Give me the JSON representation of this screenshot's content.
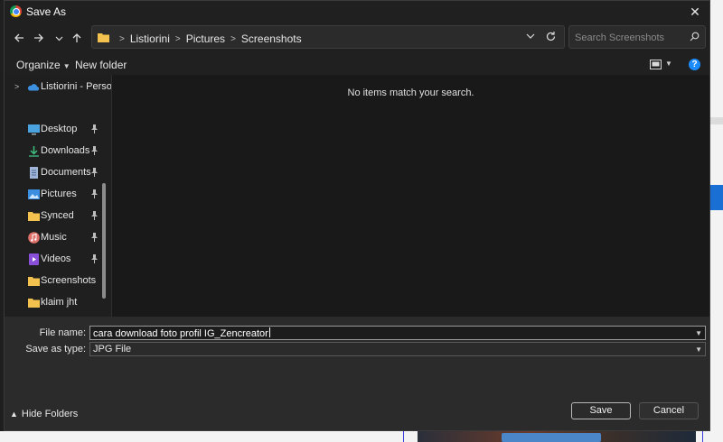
{
  "window": {
    "title": "Save As",
    "close_glyph": "✕"
  },
  "address": {
    "crumbs": [
      "Listiorini",
      "Pictures",
      "Screenshots"
    ]
  },
  "search": {
    "placeholder": "Search Screenshots"
  },
  "toolbar": {
    "organize_label": "Organize",
    "new_folder_label": "New folder",
    "help_glyph": "?"
  },
  "navpane": {
    "root_label": "Listiorini - Persor",
    "items": [
      {
        "label": "Desktop",
        "icon": "desktop-icon",
        "pinned": true
      },
      {
        "label": "Downloads",
        "icon": "download-icon",
        "pinned": true
      },
      {
        "label": "Documents",
        "icon": "document-icon",
        "pinned": true
      },
      {
        "label": "Pictures",
        "icon": "pictures-icon",
        "pinned": true
      },
      {
        "label": "Synced",
        "icon": "folder-icon",
        "pinned": true
      },
      {
        "label": "Music",
        "icon": "music-icon",
        "pinned": true
      },
      {
        "label": "Videos",
        "icon": "video-icon",
        "pinned": true
      },
      {
        "label": "Screenshots",
        "icon": "folder-icon",
        "pinned": false
      },
      {
        "label": "klaim jht",
        "icon": "folder-icon",
        "pinned": false
      }
    ]
  },
  "content": {
    "empty_message": "No items match your search."
  },
  "form": {
    "filename_label": "File name:",
    "filename_value": "cara download foto profil IG_Zencreator",
    "filetype_label": "Save as type:",
    "filetype_value": "JPG File"
  },
  "footer": {
    "hide_folders_label": "Hide Folders",
    "save_label": "Save",
    "cancel_label": "Cancel"
  },
  "colors": {
    "accent": "#1a8cff",
    "folder": "#f2c14e",
    "dialog_bg": "#202020"
  }
}
